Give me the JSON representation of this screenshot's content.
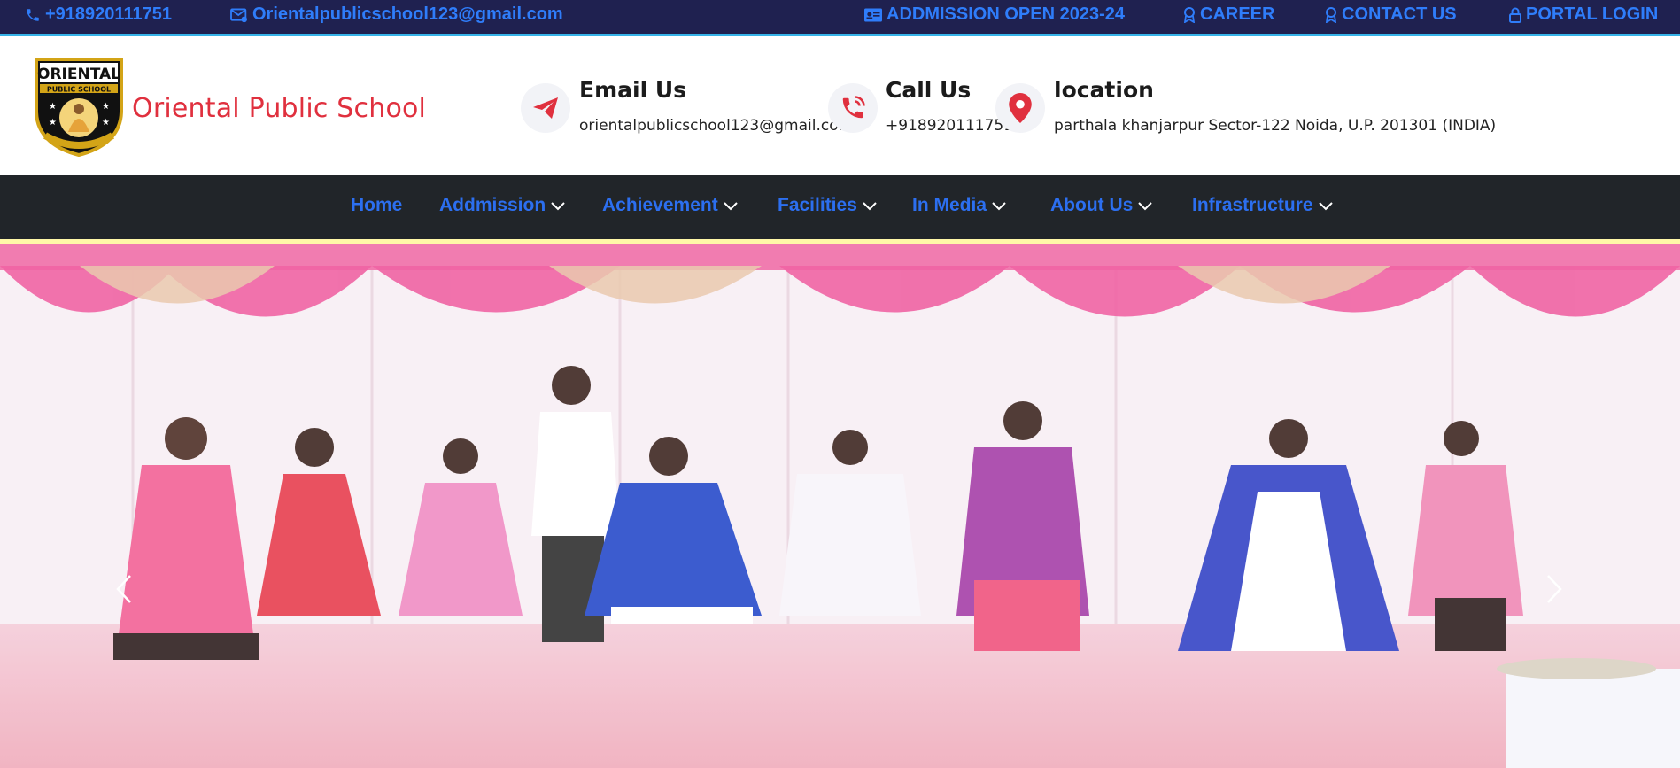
{
  "topbar": {
    "phone": "+918920111751",
    "email": "Orientalpublicschool123@gmail.com",
    "admission": "ADDMISSION OPEN 2023-24",
    "career": "CAREER",
    "contact": "CONTACT US",
    "portal": "PORTAL LOGIN"
  },
  "header": {
    "logo_text_top": "ORIENTAL",
    "logo_text_sub": "PUBLIC SCHOOL",
    "school_name": "Oriental Public School",
    "email_title": "Email Us",
    "email_value": "orientalpublicschool123@gmail.com",
    "call_title": "Call Us",
    "call_value": "+918920111751",
    "location_title": "location",
    "location_value": "parthala khanjarpur Sector-122 Noida, U.P. 201301 (INDIA)"
  },
  "nav": {
    "items": [
      {
        "label": "Home"
      },
      {
        "label": "Addmission"
      },
      {
        "label": "Achievement"
      },
      {
        "label": "Facilities"
      },
      {
        "label": "In Media"
      },
      {
        "label": "About Us"
      },
      {
        "label": "Infrastructure"
      }
    ]
  },
  "colors": {
    "topbar_bg": "#1f2150",
    "topbar_link": "#2f7dfa",
    "accent_red": "#e0303e",
    "nav_bg": "#212529",
    "nav_link": "#2c6ff0"
  }
}
